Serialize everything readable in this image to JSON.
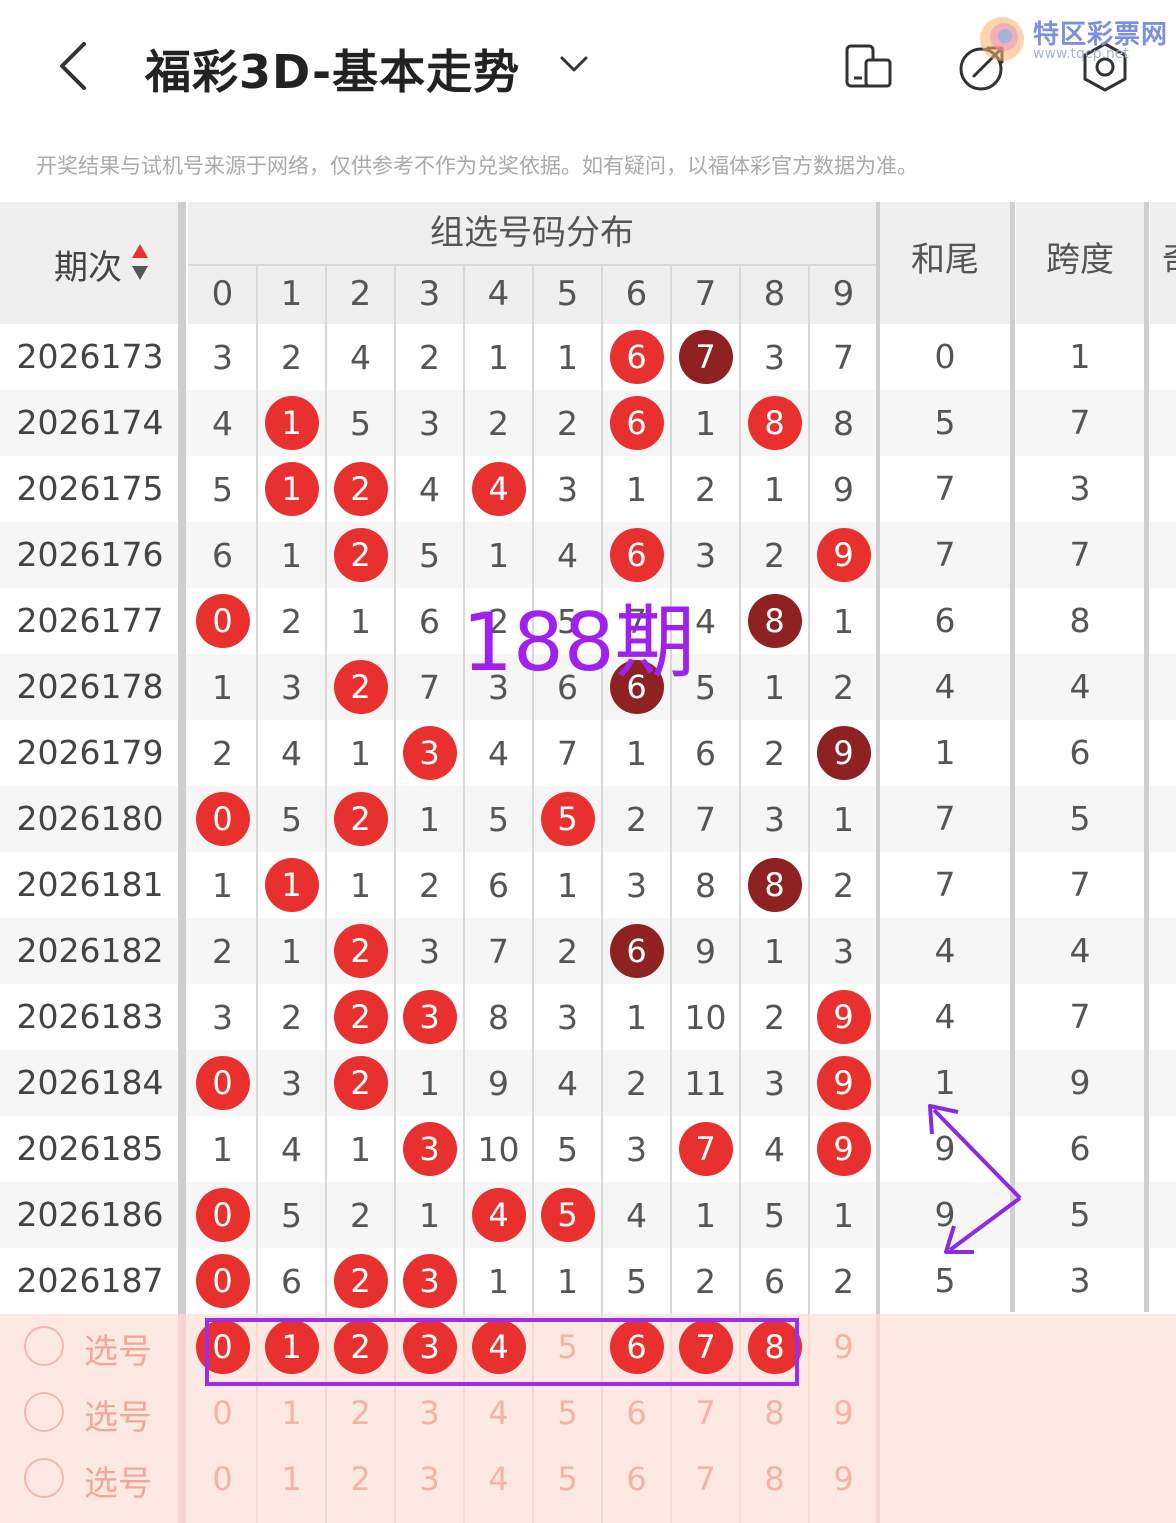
{
  "header": {
    "title": "福彩3D-基本走势",
    "back_icon": "chevron-left-icon",
    "dropdown_icon": "chevron-down-icon",
    "icons": [
      "device-switch-icon",
      "share-icon",
      "settings-icon"
    ]
  },
  "watermark": {
    "text": "特区彩票网",
    "sub": "www.tqcp.net"
  },
  "notice": "开奖结果与试机号来源于网络，仅供参考不作为兑奖依据。如有疑问，以福体彩官方数据为准。",
  "columns": {
    "period": "期次",
    "group": "组选号码分布",
    "digits": [
      "0",
      "1",
      "2",
      "3",
      "4",
      "5",
      "6",
      "7",
      "8",
      "9"
    ],
    "sum_tail": "和尾",
    "span": "跨度",
    "cut": "奇"
  },
  "rows": [
    {
      "period": "2026173",
      "cells": [
        {
          "v": "3"
        },
        {
          "v": "2"
        },
        {
          "v": "4"
        },
        {
          "v": "2"
        },
        {
          "v": "1"
        },
        {
          "v": "1"
        },
        {
          "v": "6",
          "ball": "red"
        },
        {
          "v": "7",
          "ball": "dark"
        },
        {
          "v": "3"
        },
        {
          "v": "7"
        }
      ],
      "sum": "0",
      "span": "1"
    },
    {
      "period": "2026174",
      "cells": [
        {
          "v": "4"
        },
        {
          "v": "1",
          "ball": "red"
        },
        {
          "v": "5"
        },
        {
          "v": "3"
        },
        {
          "v": "2"
        },
        {
          "v": "2"
        },
        {
          "v": "6",
          "ball": "red"
        },
        {
          "v": "1"
        },
        {
          "v": "8",
          "ball": "red"
        },
        {
          "v": "8"
        }
      ],
      "sum": "5",
      "span": "7"
    },
    {
      "period": "2026175",
      "cells": [
        {
          "v": "5"
        },
        {
          "v": "1",
          "ball": "red"
        },
        {
          "v": "2",
          "ball": "red"
        },
        {
          "v": "4"
        },
        {
          "v": "4",
          "ball": "red"
        },
        {
          "v": "3"
        },
        {
          "v": "1"
        },
        {
          "v": "2"
        },
        {
          "v": "1"
        },
        {
          "v": "9"
        }
      ],
      "sum": "7",
      "span": "3"
    },
    {
      "period": "2026176",
      "cells": [
        {
          "v": "6"
        },
        {
          "v": "1"
        },
        {
          "v": "2",
          "ball": "red"
        },
        {
          "v": "5"
        },
        {
          "v": "1"
        },
        {
          "v": "4"
        },
        {
          "v": "6",
          "ball": "red"
        },
        {
          "v": "3"
        },
        {
          "v": "2"
        },
        {
          "v": "9",
          "ball": "red"
        }
      ],
      "sum": "7",
      "span": "7"
    },
    {
      "period": "2026177",
      "cells": [
        {
          "v": "0",
          "ball": "red"
        },
        {
          "v": "2"
        },
        {
          "v": "1"
        },
        {
          "v": "6"
        },
        {
          "v": "2"
        },
        {
          "v": "5"
        },
        {
          "v": "7"
        },
        {
          "v": "4"
        },
        {
          "v": "8",
          "ball": "dark"
        },
        {
          "v": "1"
        }
      ],
      "sum": "6",
      "span": "8"
    },
    {
      "period": "2026178",
      "cells": [
        {
          "v": "1"
        },
        {
          "v": "3"
        },
        {
          "v": "2",
          "ball": "red"
        },
        {
          "v": "7"
        },
        {
          "v": "3"
        },
        {
          "v": "6"
        },
        {
          "v": "6",
          "ball": "dark"
        },
        {
          "v": "5"
        },
        {
          "v": "1"
        },
        {
          "v": "2"
        }
      ],
      "sum": "4",
      "span": "4"
    },
    {
      "period": "2026179",
      "cells": [
        {
          "v": "2"
        },
        {
          "v": "4"
        },
        {
          "v": "1"
        },
        {
          "v": "3",
          "ball": "red"
        },
        {
          "v": "4"
        },
        {
          "v": "7"
        },
        {
          "v": "1"
        },
        {
          "v": "6"
        },
        {
          "v": "2"
        },
        {
          "v": "9",
          "ball": "dark"
        }
      ],
      "sum": "1",
      "span": "6"
    },
    {
      "period": "2026180",
      "cells": [
        {
          "v": "0",
          "ball": "red"
        },
        {
          "v": "5"
        },
        {
          "v": "2",
          "ball": "red"
        },
        {
          "v": "1"
        },
        {
          "v": "5"
        },
        {
          "v": "5",
          "ball": "red"
        },
        {
          "v": "2"
        },
        {
          "v": "7"
        },
        {
          "v": "3"
        },
        {
          "v": "1"
        }
      ],
      "sum": "7",
      "span": "5"
    },
    {
      "period": "2026181",
      "cells": [
        {
          "v": "1"
        },
        {
          "v": "1",
          "ball": "red"
        },
        {
          "v": "1"
        },
        {
          "v": "2"
        },
        {
          "v": "6"
        },
        {
          "v": "1"
        },
        {
          "v": "3"
        },
        {
          "v": "8"
        },
        {
          "v": "8",
          "ball": "dark"
        },
        {
          "v": "2"
        }
      ],
      "sum": "7",
      "span": "7"
    },
    {
      "period": "2026182",
      "cells": [
        {
          "v": "2"
        },
        {
          "v": "1"
        },
        {
          "v": "2",
          "ball": "red"
        },
        {
          "v": "3"
        },
        {
          "v": "7"
        },
        {
          "v": "2"
        },
        {
          "v": "6",
          "ball": "dark"
        },
        {
          "v": "9"
        },
        {
          "v": "1"
        },
        {
          "v": "3"
        }
      ],
      "sum": "4",
      "span": "4"
    },
    {
      "period": "2026183",
      "cells": [
        {
          "v": "3"
        },
        {
          "v": "2"
        },
        {
          "v": "2",
          "ball": "red"
        },
        {
          "v": "3",
          "ball": "red"
        },
        {
          "v": "8"
        },
        {
          "v": "3"
        },
        {
          "v": "1"
        },
        {
          "v": "10"
        },
        {
          "v": "2"
        },
        {
          "v": "9",
          "ball": "red"
        }
      ],
      "sum": "4",
      "span": "7"
    },
    {
      "period": "2026184",
      "cells": [
        {
          "v": "0",
          "ball": "red"
        },
        {
          "v": "3"
        },
        {
          "v": "2",
          "ball": "red"
        },
        {
          "v": "1"
        },
        {
          "v": "9"
        },
        {
          "v": "4"
        },
        {
          "v": "2"
        },
        {
          "v": "11"
        },
        {
          "v": "3"
        },
        {
          "v": "9",
          "ball": "red"
        }
      ],
      "sum": "1",
      "span": "9"
    },
    {
      "period": "2026185",
      "cells": [
        {
          "v": "1"
        },
        {
          "v": "4"
        },
        {
          "v": "1"
        },
        {
          "v": "3",
          "ball": "red"
        },
        {
          "v": "10"
        },
        {
          "v": "5"
        },
        {
          "v": "3"
        },
        {
          "v": "7",
          "ball": "red"
        },
        {
          "v": "4"
        },
        {
          "v": "9",
          "ball": "red"
        }
      ],
      "sum": "9",
      "span": "6"
    },
    {
      "period": "2026186",
      "cells": [
        {
          "v": "0",
          "ball": "red"
        },
        {
          "v": "5"
        },
        {
          "v": "2"
        },
        {
          "v": "1"
        },
        {
          "v": "4",
          "ball": "red"
        },
        {
          "v": "5",
          "ball": "red"
        },
        {
          "v": "4"
        },
        {
          "v": "1"
        },
        {
          "v": "5"
        },
        {
          "v": "1"
        }
      ],
      "sum": "9",
      "span": "5"
    },
    {
      "period": "2026187",
      "cells": [
        {
          "v": "0",
          "ball": "red"
        },
        {
          "v": "6"
        },
        {
          "v": "2",
          "ball": "red"
        },
        {
          "v": "3",
          "ball": "red"
        },
        {
          "v": "1"
        },
        {
          "v": "1"
        },
        {
          "v": "5"
        },
        {
          "v": "2"
        },
        {
          "v": "6"
        },
        {
          "v": "2"
        }
      ],
      "sum": "5",
      "span": "3"
    }
  ],
  "picker": {
    "label": "选号",
    "rows": [
      {
        "selected": [
          true,
          true,
          true,
          true,
          true,
          false,
          true,
          true,
          true,
          false
        ]
      },
      {
        "selected": [
          false,
          false,
          false,
          false,
          false,
          false,
          false,
          false,
          false,
          false
        ]
      },
      {
        "selected": [
          false,
          false,
          false,
          false,
          false,
          false,
          false,
          false,
          false,
          false
        ]
      }
    ]
  },
  "annotation": {
    "text": "188期",
    "color": "#a020f0"
  },
  "colors": {
    "ball_red": "#e8312f",
    "ball_dark": "#8e2121",
    "annotation": "#9b2cf0"
  }
}
